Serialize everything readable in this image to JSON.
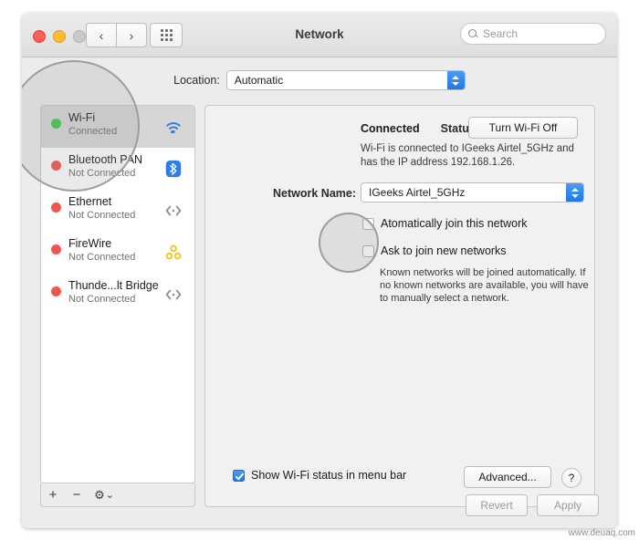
{
  "window": {
    "title": "Network",
    "search_placeholder": "Search",
    "nav_back": "‹",
    "nav_forward": "›"
  },
  "location": {
    "label": "Location:",
    "value": "Automatic"
  },
  "sidebar": {
    "services": [
      {
        "name": "Wi-Fi",
        "status": "Connected",
        "led": "green",
        "icon": "wifi-icon"
      },
      {
        "name": "Bluetooth PAN",
        "status": "Not Connected",
        "led": "red",
        "icon": "bluetooth-icon"
      },
      {
        "name": "Ethernet",
        "status": "Not Connected",
        "led": "red",
        "icon": "ethernet-icon"
      },
      {
        "name": "FireWire",
        "status": "Not Connected",
        "led": "red",
        "icon": "firewire-icon"
      },
      {
        "name": "Thunde...lt Bridge",
        "status": "Not Connected",
        "led": "red",
        "icon": "ethernet-icon"
      }
    ],
    "footer": {
      "add": "+",
      "remove": "−",
      "actions": "⚙",
      "actions_arrow": "⌄"
    }
  },
  "detail": {
    "status_label": "Status:",
    "status_value": "Connected",
    "turn_off_button": "Turn Wi-Fi Off",
    "status_desc_line1": "Wi-Fi is connected to IGeeks Airtel_5GHz and",
    "status_desc_line2": "has the IP address 192.168.1.26.",
    "network_name_label": "Network Name:",
    "network_name_value": "IGeeks Airtel_5GHz",
    "auto_join_label": "Atomatically join this network",
    "auto_join_checked": false,
    "ask_join_label": "Ask to join new networks",
    "ask_join_checked": false,
    "ask_join_note_line1": "Known networks will be joined automatically. If",
    "ask_join_note_line2": "no known networks are available, you will have",
    "ask_join_note_line3": "to manually select a network.",
    "show_status_label": "Show Wi-Fi status in menu bar",
    "show_status_checked": true,
    "advanced_button": "Advanced...",
    "help_button": "?"
  },
  "footer": {
    "revert_button": "Revert",
    "apply_button": "Apply"
  },
  "watermark": "www.deuaq.com",
  "colors": {
    "accent": "#2f7ce8",
    "led_green": "#45c44b",
    "led_red": "#f1554a"
  }
}
